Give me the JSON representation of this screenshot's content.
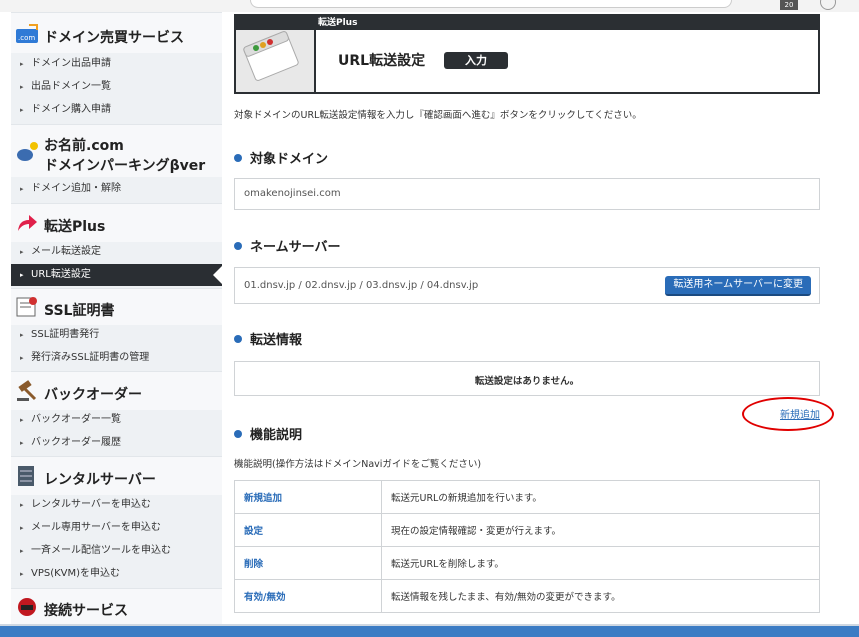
{
  "browser": {
    "tab_badge": "20"
  },
  "sidebar": {
    "sections": [
      {
        "title": "ドメイン売買サービス",
        "icon": "com-icon",
        "icon_text": ".com",
        "items": [
          "ドメイン出品申請",
          "出品ドメイン一覧",
          "ドメイン購入申請"
        ]
      },
      {
        "title_line1": "お名前.com",
        "title_line2": "ドメインパーキングβver",
        "icon": "coins-icon",
        "items": [
          "ドメイン追加・解除"
        ]
      },
      {
        "title": "転送Plus",
        "icon": "forward-arrow-icon",
        "items": [
          "メール転送設定",
          "URL転送設定"
        ]
      },
      {
        "title": "SSL証明書",
        "icon": "certificate-icon",
        "items": [
          "SSL証明書発行",
          "発行済みSSL証明書の管理"
        ]
      },
      {
        "title": "バックオーダー",
        "icon": "gavel-icon",
        "items": [
          "バックオーダー一覧",
          "バックオーダー履歴"
        ]
      },
      {
        "title": "レンタルサーバー",
        "icon": "server-icon",
        "items": [
          "レンタルサーバーを申込む",
          "メール専用サーバーを申込む",
          "一斉メール配信ツールを申込む",
          "VPS(KVM)を申込む"
        ]
      },
      {
        "title": "接続サービス",
        "icon": "router-icon",
        "items": []
      }
    ]
  },
  "header": {
    "caption": "転送Plus",
    "title": "URL転送設定",
    "step": "入力"
  },
  "description": "対象ドメインのURL転送設定情報を入力し『確認画面へ進む』ボタンをクリックしてください。",
  "target_domain": {
    "heading": "対象ドメイン",
    "value": "omakenojinsei.com"
  },
  "nameserver": {
    "heading": "ネームサーバー",
    "value": "01.dnsv.jp / 02.dnsv.jp / 03.dnsv.jp / 04.dnsv.jp",
    "button": "転送用ネームサーバーに変更"
  },
  "forwarding": {
    "heading": "転送情報",
    "empty_message": "転送設定はありません。",
    "add_link": "新規追加"
  },
  "features": {
    "heading": "機能説明",
    "note": "機能説明(操作方法はドメインNaviガイドをご覧ください)",
    "rows": [
      {
        "name": "新規追加",
        "desc": "転送元URLの新規追加を行います。"
      },
      {
        "name": "設定",
        "desc": "現在の設定情報確認・変更が行えます。"
      },
      {
        "name": "削除",
        "desc": "転送元URLを削除します。"
      },
      {
        "name": "有効/無効",
        "desc": "転送情報を残したまま、有効/無効の変更ができます。"
      }
    ]
  },
  "colors": {
    "accent": "#2a6cb8",
    "dark": "#2b2f33",
    "highlight": "#e00000"
  }
}
